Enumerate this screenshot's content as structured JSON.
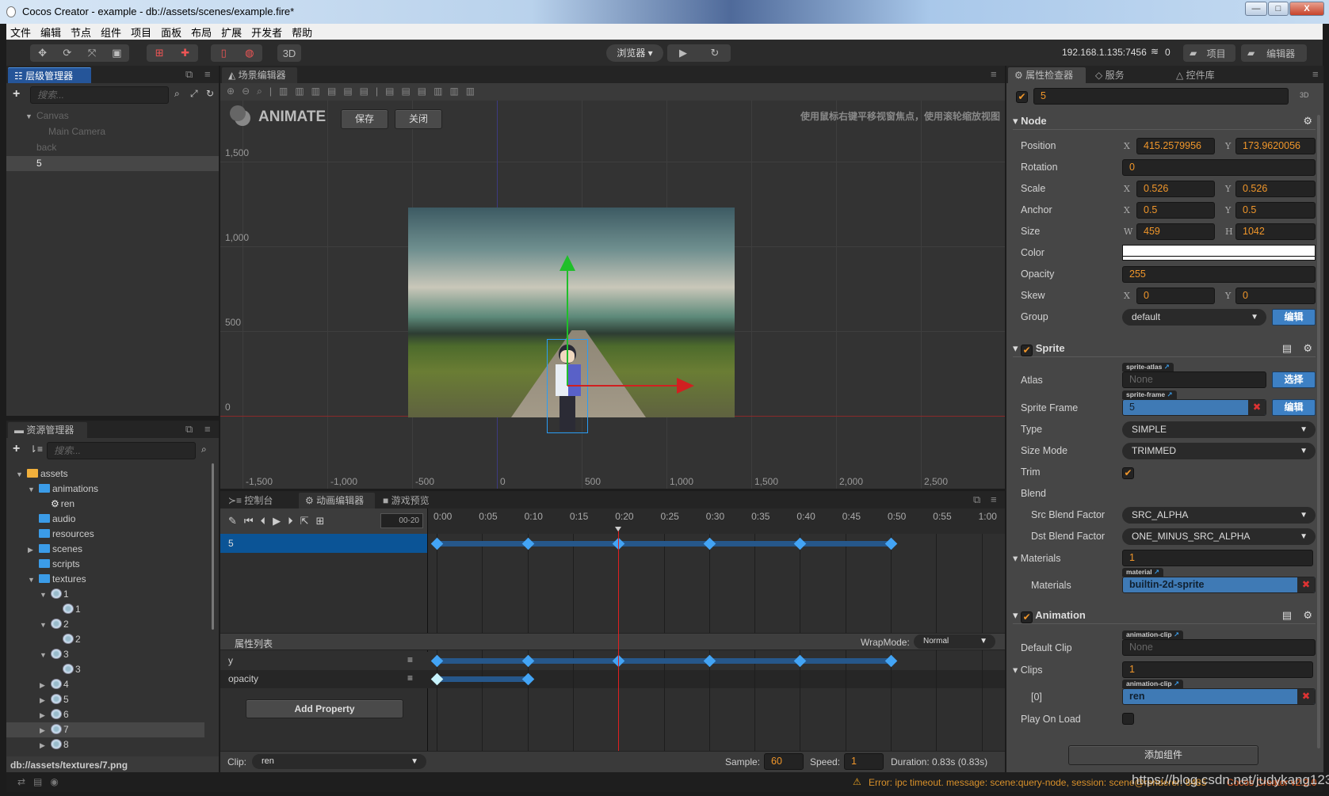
{
  "window": {
    "title": "Cocos Creator - example - db://assets/scenes/example.fire*",
    "minimize": "—",
    "maximize": "□",
    "close": "X"
  },
  "menu": [
    "文件",
    "编辑",
    "节点",
    "组件",
    "项目",
    "面板",
    "布局",
    "扩展",
    "开发者",
    "帮助"
  ],
  "toolbar": {
    "browser_label": "浏览器 ▾",
    "play_icon": "play-icon",
    "refresh_icon": "refresh-icon",
    "mode_3d": "3D",
    "ip": "192.168.1.135:7456",
    "device_count": "0",
    "project_btn": "项目",
    "editor_btn": "编辑器"
  },
  "hierarchy": {
    "tab": "层级管理器",
    "search_placeholder": "搜索...",
    "nodes": [
      {
        "label": "Canvas"
      },
      {
        "label": "Main Camera"
      },
      {
        "label": "back"
      },
      {
        "label": "5"
      }
    ]
  },
  "assets": {
    "tab": "资源管理器",
    "search_placeholder": "搜索...",
    "tree": [
      {
        "label": "assets"
      },
      {
        "label": "animations"
      },
      {
        "label": "ren"
      },
      {
        "label": "audio"
      },
      {
        "label": "resources"
      },
      {
        "label": "scenes"
      },
      {
        "label": "scripts"
      },
      {
        "label": "textures"
      },
      {
        "label": "1"
      },
      {
        "label": "1"
      },
      {
        "label": "2"
      },
      {
        "label": "2"
      },
      {
        "label": "3"
      },
      {
        "label": "3"
      },
      {
        "label": "4"
      },
      {
        "label": "5"
      },
      {
        "label": "6"
      },
      {
        "label": "7"
      },
      {
        "label": "8"
      }
    ],
    "selected_path": "db://assets/textures/7.png"
  },
  "scene": {
    "tab": "场景编辑器",
    "mode": "ANIMATE",
    "save_btn": "保存",
    "close_btn": "关闭",
    "hint": "使用鼠标右键平移视窗焦点，使用滚轮缩放视图",
    "y_labels": [
      "1,500",
      "1,000",
      "500",
      "0"
    ],
    "x_labels": [
      "-1,500",
      "-1,000",
      "-500",
      "0",
      "500",
      "1,000",
      "1,500",
      "2,000",
      "2,500"
    ]
  },
  "bottom_tabs": {
    "console": "控制台",
    "animation": "动画编辑器",
    "preview": "游戏预览"
  },
  "animation": {
    "current_frame": "00-20",
    "ruler": [
      "0:00",
      "0:05",
      "0:10",
      "0:15",
      "0:20",
      "0:25",
      "0:30",
      "0:35",
      "0:40",
      "0:45",
      "0:50",
      "0:55",
      "1:00"
    ],
    "current_time": "0:20",
    "node_row": {
      "label": "5",
      "keyframes": [
        "0:00",
        "0:10",
        "0:20",
        "0:30",
        "0:40",
        "0:50"
      ]
    },
    "property_list_title": "属性列表",
    "wrapmode_label": "WrapMode:",
    "wrapmode_value": "Normal",
    "properties": [
      {
        "name": "y",
        "keyframes": [
          "0:00",
          "0:10",
          "0:20",
          "0:30",
          "0:40",
          "0:50"
        ]
      },
      {
        "name": "opacity",
        "keyframes": [
          "0:00",
          "0:10"
        ]
      }
    ],
    "add_property": "Add Property",
    "clip_label": "Clip:",
    "clip_value": "ren",
    "sample_label": "Sample:",
    "sample_value": "60",
    "speed_label": "Speed:",
    "speed_value": "1",
    "duration": "Duration: 0.83s (0.83s)"
  },
  "inspector": {
    "tabs": [
      "属性检查器",
      "服务",
      "控件库"
    ],
    "node_name": "5",
    "badge_3d": "3D",
    "node_section": "Node",
    "position": {
      "label": "Position",
      "x": "415.2579956",
      "y": "173.9620056"
    },
    "rotation": {
      "label": "Rotation",
      "value": "0"
    },
    "scale": {
      "label": "Scale",
      "x": "0.526",
      "y": "0.526"
    },
    "anchor": {
      "label": "Anchor",
      "x": "0.5",
      "y": "0.5"
    },
    "size": {
      "label": "Size",
      "w": "459",
      "h": "1042"
    },
    "color": {
      "label": "Color",
      "value": "#ffffff"
    },
    "opacity": {
      "label": "Opacity",
      "value": "255"
    },
    "skew": {
      "label": "Skew",
      "x": "0",
      "y": "0"
    },
    "group": {
      "label": "Group",
      "value": "default",
      "edit": "编辑"
    },
    "sprite_section": "Sprite",
    "atlas": {
      "label": "Atlas",
      "tag": "sprite-atlas",
      "value": "None",
      "btn": "选择"
    },
    "sprite_frame": {
      "label": "Sprite Frame",
      "tag": "sprite-frame",
      "value": "5",
      "btn": "编辑"
    },
    "type": {
      "label": "Type",
      "value": "SIMPLE"
    },
    "size_mode": {
      "label": "Size Mode",
      "value": "TRIMMED"
    },
    "trim": {
      "label": "Trim",
      "checked": true
    },
    "blend": {
      "label": "Blend"
    },
    "src_blend": {
      "label": "Src Blend Factor",
      "value": "SRC_ALPHA"
    },
    "dst_blend": {
      "label": "Dst Blend Factor",
      "value": "ONE_MINUS_SRC_ALPHA"
    },
    "materials": {
      "label": "Materials",
      "count": "1",
      "item_label": "Materials",
      "tag": "material",
      "value": "builtin-2d-sprite"
    },
    "animation_section": "Animation",
    "default_clip": {
      "label": "Default Clip",
      "tag": "animation-clip",
      "value": "None"
    },
    "clips": {
      "label": "Clips",
      "count": "1",
      "item_label": "[0]",
      "tag": "animation-clip",
      "value": "ren"
    },
    "play_on_load": {
      "label": "Play On Load",
      "checked": false
    },
    "add_component": "添加组件"
  },
  "status": {
    "error": "Error: ipc timeout. message: scene:query-node, session: scene@renderer: 8485",
    "version": "Cocos Creator v2.2.0",
    "watermark": "https://blog.csdn.net/judykang123"
  },
  "colors": {
    "accent_blue": "#3f7ab5",
    "value_orange": "#f0962a",
    "keyframe": "#43a4f5",
    "playhead": "#e02020"
  }
}
